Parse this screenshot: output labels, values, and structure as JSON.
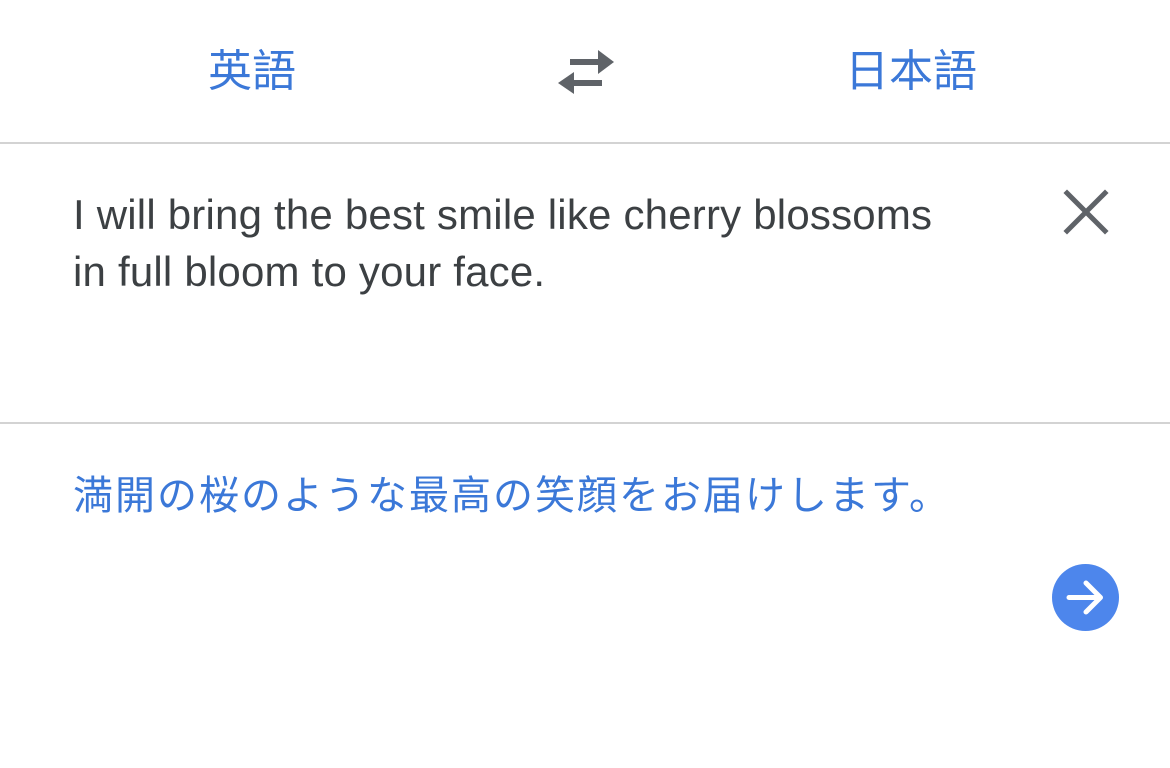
{
  "header": {
    "source_language": "英語",
    "target_language": "日本語",
    "swap_icon": "swap-arrows-icon"
  },
  "source": {
    "text": "I will bring the best smile like cherry blossoms in full bloom to your face.",
    "clear_icon": "close-icon"
  },
  "result": {
    "text": "満開の桜のような最高の笑顔をお届けします。",
    "go_icon": "arrow-right-icon"
  },
  "colors": {
    "accent": "#3b78d8",
    "button": "#4d86ec",
    "source_text": "#3c4043",
    "divider": "#d3d3d3",
    "icon_gray": "#5f6368"
  }
}
